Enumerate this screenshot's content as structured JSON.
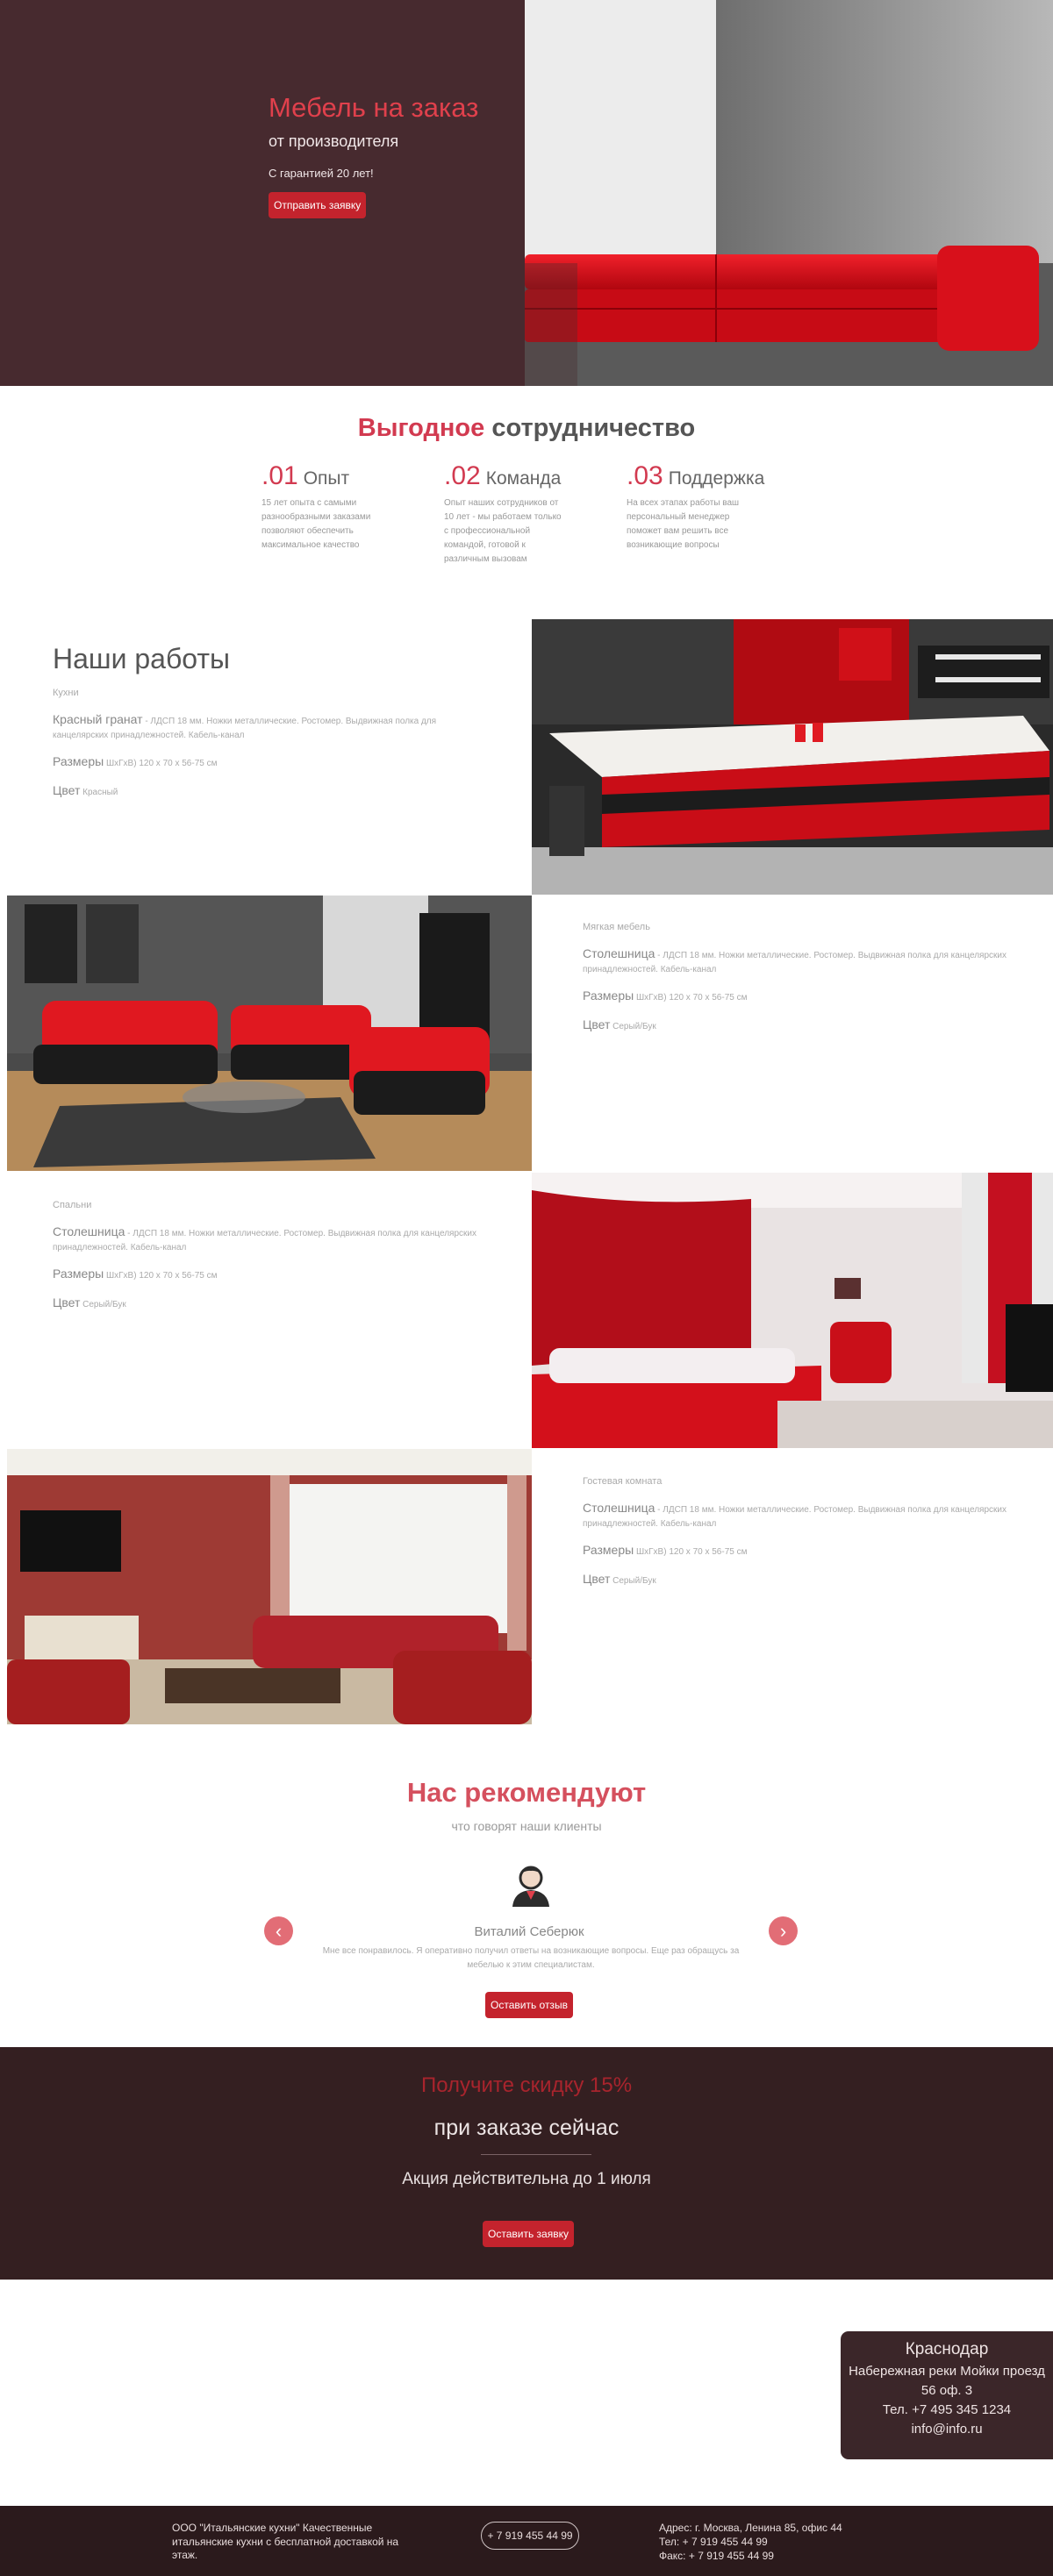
{
  "hero": {
    "title": "Мебель на заказ",
    "subtitle": "от производителя",
    "guarantee": "С гарантией 20 лет!",
    "button": "Отправить заявку"
  },
  "cooperation": {
    "title_accent": "Выгодное",
    "title_rest": "сотрудничество",
    "features": [
      {
        "num": ".01",
        "name": "Опыт",
        "text": "15 лет опыта с самыми разнообразными заказами позволяют обеспечить максимальное качество"
      },
      {
        "num": ".02",
        "name": "Команда",
        "text": "Опыт наших сотрудников от 10 лет - мы работаем только с профессиональной командой, готовой к различным вызовам"
      },
      {
        "num": ".03",
        "name": "Поддержка",
        "text": "На всех этапах работы ваш персональный менеджер поможет вам решить все возникающие вопросы"
      }
    ]
  },
  "works": {
    "heading": "Наши работы",
    "items": [
      {
        "category": "Кухни",
        "material_label": "Красный гранат",
        "material_text": " - ЛДСП 18 мм. Ножки металлические. Ростомер. Выдвижная полка для канцелярских принадлежностей. Кабель-канал",
        "size_label": "Размеры",
        "size_text": " ШхГхВ) 120 х 70 х 56-75 см",
        "color_label": "Цвет",
        "color_text": " Красный"
      },
      {
        "category": "Мягкая мебель",
        "material_label": "Столешница",
        "material_text": " - ЛДСП 18 мм. Ножки металлические. Ростомер. Выдвижная полка для канцелярских принадлежностей. Кабель-канал",
        "size_label": "Размеры",
        "size_text": " ШхГхВ) 120 х 70 х 56-75 см",
        "color_label": "Цвет",
        "color_text": " Серый/Бук"
      },
      {
        "category": "Спальни",
        "material_label": "Столешница",
        "material_text": " - ЛДСП 18 мм. Ножки металлические. Ростомер. Выдвижная полка для канцелярских принадлежностей. Кабель-канал",
        "size_label": "Размеры",
        "size_text": " ШхГхВ) 120 х 70 х 56-75 см",
        "color_label": "Цвет",
        "color_text": " Серый/Бук"
      },
      {
        "category": "Гостевая комната",
        "material_label": "Столешница",
        "material_text": " - ЛДСП 18 мм. Ножки металлические. Ростомер. Выдвижная полка для канцелярских принадлежностей. Кабель-канал",
        "size_label": "Размеры",
        "size_text": " ШхГхВ) 120 х 70 х 56-75 см",
        "color_label": "Цвет",
        "color_text": " Серый/Бук"
      }
    ]
  },
  "testimonials": {
    "title": "Нас рекомендуют",
    "subtitle": "что говорят наши клиенты",
    "name": "Виталий Себерюк",
    "text": "Мне все понравилось. Я оперативно получил ответы на возникающие вопросы. Еще раз обращусь за мебелью к этим специалистам.",
    "button": "Оставить отзыв",
    "prev_icon": "chevron-left-icon",
    "next_icon": "chevron-right-icon"
  },
  "discount": {
    "title": "Получите скидку 15%",
    "subtitle": "при заказе сейчас",
    "note": "Акция действительна до 1 июля",
    "button": "Оставить заявку"
  },
  "contact_card": {
    "city": "Краснодар",
    "street": "Набережная реки Мойки проезд",
    "office": "56 оф. 3",
    "phone": "Тел. +7 495 345 1234",
    "email": "info@info.ru"
  },
  "footer": {
    "about": "ООО \"Итальянские кухни\" Качественные итальянские кухни с бесплатной доставкой на этаж.",
    "phone": "+ 7 919 455 44 99",
    "address": "Адрес: г. Москва, Ленина 85, офис 44",
    "tel": "Тел: + 7 919 455 44 99",
    "fax": "Факс: + 7 919 455 44 99"
  },
  "colors": {
    "accent": "#d23a50",
    "button": "#c4232d",
    "hero_bg": "#472a2f",
    "discount_bg": "#341f21",
    "footer_bg": "#2b1a1c"
  }
}
